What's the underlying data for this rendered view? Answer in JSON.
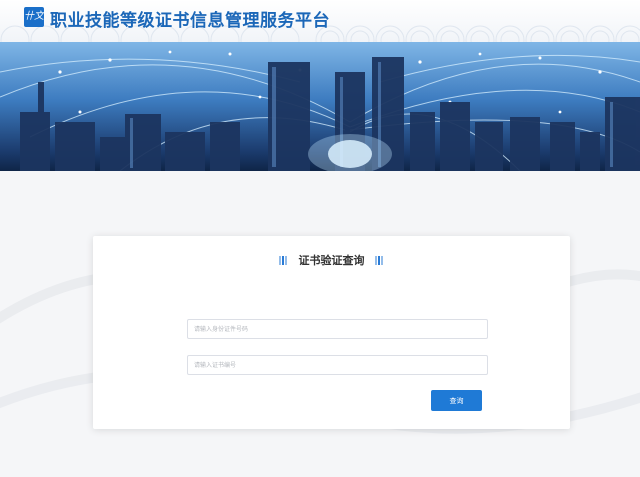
{
  "header": {
    "logo_glyph": "卄文",
    "title": "职业技能等级证书信息管理服务平台"
  },
  "card": {
    "title": "证书验证查询",
    "id_placeholder": "请输入身份证件号码",
    "cert_placeholder": "请输入证书编号",
    "query_button": "查询"
  },
  "colors": {
    "accent": "#1f7ad6",
    "title": "#1b67b8"
  }
}
